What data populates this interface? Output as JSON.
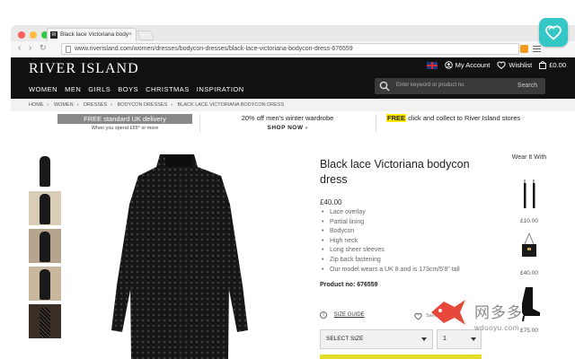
{
  "browser": {
    "tab_title": "Black lace Victoriana body",
    "tab_favicon_text": "RI",
    "url": "www.riverisland.com/women/dresses/bodycon-dresses/black-lace-victoriana-bodycon-dress-676559"
  },
  "header": {
    "logo": "RIVER ISLAND",
    "account": "My Account",
    "wishlist": "Wishlist",
    "bag_total": "£0.00",
    "nav": [
      "WOMEN",
      "MEN",
      "GIRLS",
      "BOYS",
      "CHRISTMAS",
      "INSPIRATION"
    ],
    "search_placeholder": "Enter keyword or product no.",
    "search_button": "Search"
  },
  "breadcrumb": [
    "HOME",
    "WOMEN",
    "DRESSES",
    "BODYCON DRESSES",
    "BLACK LACE VICTORIANA BODYCON DRESS"
  ],
  "promos": {
    "delivery": "FREE standard UK delivery",
    "delivery_sub": "When you spend £65* or more",
    "menswear": "20% off men's winter wardrobe",
    "menswear_cta": "SHOP NOW",
    "collect_free": "FREE",
    "collect_rest": " click and collect to River Island stores"
  },
  "product": {
    "title": "Black lace Victoriana bodycon dress",
    "price": "£40.00",
    "features": [
      "Lace overlay",
      "Partial lining",
      "Bodycon",
      "High neck",
      "Long sheer sleeves",
      "Zip back fastening",
      "Our model wears a UK 8 and is 173cm/5'8\" tall"
    ],
    "product_no": "Product no: 676559",
    "size_guide": "SIZE GUIDE",
    "save_for_later": "Save for later",
    "select_size": "SELECT SIZE",
    "quantity": "1"
  },
  "wear_it_with": {
    "title": "Wear It With",
    "items": [
      {
        "price": "£10.00",
        "icon": "earrings-icon"
      },
      {
        "price": "£40.00",
        "icon": "handbag-icon"
      },
      {
        "price": "£75.00",
        "icon": "boot-icon"
      }
    ]
  },
  "watermark": {
    "cn": "网多多",
    "url": "wduoyu.com"
  },
  "colors": {
    "header_bg": "#111111",
    "ext_badge": "#35c6c6",
    "add_to_bag": "#e4dc2a",
    "promo_band": "#888888",
    "highlight": "#ffea00"
  }
}
